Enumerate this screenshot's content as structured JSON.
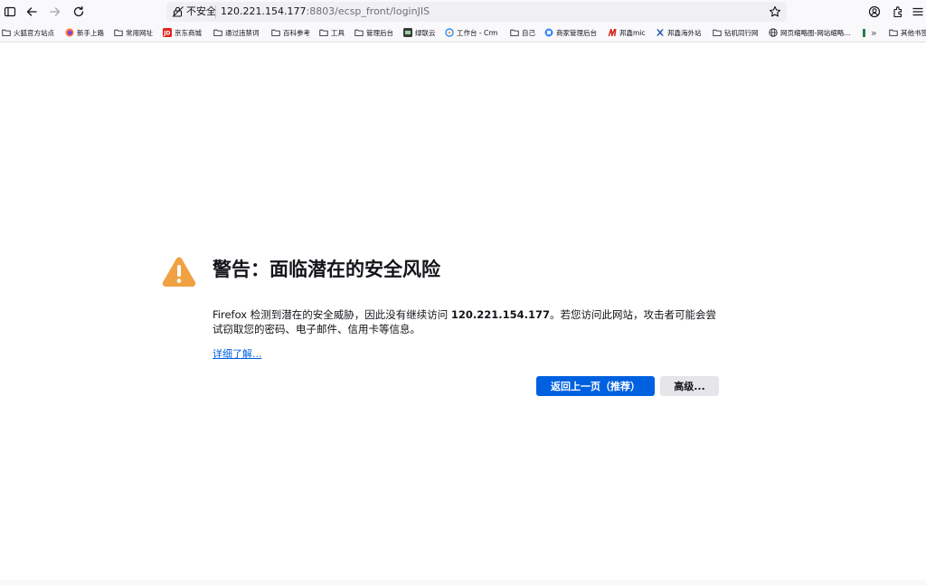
{
  "toolbar": {
    "sidebar_icon": "sidebar-icon",
    "back_icon": "back-arrow-icon",
    "forward_icon": "forward-arrow-icon",
    "reload_icon": "reload-icon",
    "urlbar": {
      "security_label": "不安全",
      "url_host": "120.221.154.177",
      "url_rest": ":8803/ecsp_front/loginJIS",
      "security_icon": "insecure-lock-icon",
      "bookmark_icon": "star-icon"
    },
    "account_icon": "account-icon",
    "extensions_icon": "extensions-icon",
    "menu_icon": "hamburger-menu-icon"
  },
  "bookmarks": [
    {
      "label": "火狐官方站点",
      "icon": "folder"
    },
    {
      "label": "新手上路",
      "icon": "firefox"
    },
    {
      "label": "常用网址",
      "icon": "folder"
    },
    {
      "label": "京东商城",
      "icon": "jd"
    },
    {
      "label": "通过违禁词",
      "icon": "folder"
    },
    {
      "label": "百科参考",
      "icon": "folder"
    },
    {
      "label": "工具",
      "icon": "folder"
    },
    {
      "label": "管理后台",
      "icon": "folder"
    },
    {
      "label": "绿联云",
      "icon": "ugreen"
    },
    {
      "label": "工作台 - Crm",
      "icon": "crm"
    },
    {
      "label": "自己",
      "icon": "folder"
    },
    {
      "label": "商家管理后台",
      "icon": "shop"
    },
    {
      "label": "邦鑫mic",
      "icon": "mic"
    },
    {
      "label": "邦鑫海外站",
      "icon": "bx"
    },
    {
      "label": "钻机同行网",
      "icon": "folder"
    },
    {
      "label": "网页缩略图-网站缩略...",
      "icon": "globe"
    },
    {
      "label": "其他书签",
      "icon": "folder"
    }
  ],
  "error_page": {
    "title": "警告：面临潜在的安全风险",
    "desc_part1": "Firefox 检测到潜在的安全威胁，因此没有继续访问 ",
    "desc_host": "120.221.154.177",
    "desc_part2": "。若您访问此网站，攻击者可能会尝试窃取您的密码、电子邮件、信用卡等信息。",
    "learn_more": "详细了解...",
    "go_back_button": "返回上一页（推荐）",
    "advanced_button": "高级...",
    "colors": {
      "accent": "#0061e0",
      "warning": "#f0a142"
    }
  }
}
